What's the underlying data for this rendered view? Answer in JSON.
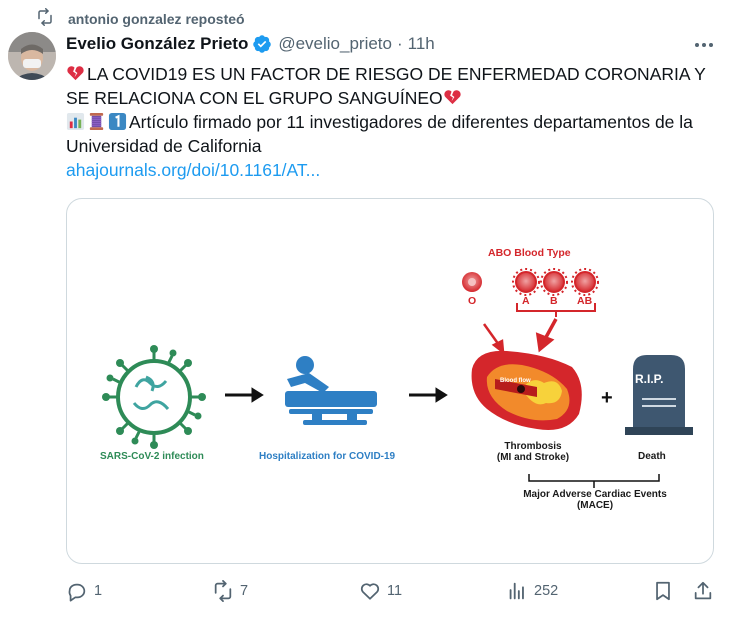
{
  "repost": {
    "text": "antonio gonzalez reposteó",
    "icon": "repost-icon"
  },
  "author": {
    "name": "Evelio González Prieto",
    "handle": "@evelio_prieto",
    "separator": "·",
    "time": "11h",
    "verified": true
  },
  "tweet": {
    "line1": "LA COVID19 ES UN FACTOR DE RIESGO DE ENFERMEDAD CORONARIA Y SE RELACIONA CON EL GRUPO SANGUÍNEO",
    "line2": "Artículo firmado por 11 investigadores de diferentes departamentos de la Universidad de California",
    "link": "ahajournals.org/doi/10.1161/AT..."
  },
  "figure": {
    "sars_label": "SARS-CoV-2 infection",
    "hosp_label": "Hospitalization  for COVID-19",
    "abo_title": "ABO Blood Type",
    "blood_types": [
      "O",
      "A",
      "B",
      "AB"
    ],
    "blood_flow": "Blood flow",
    "thrombosis": [
      "Thrombosis",
      "(MI and Stroke)"
    ],
    "plus": "+",
    "tombstone": "R.I.P.",
    "death": "Death",
    "mace": [
      "Major Adverse Cardiac Events",
      "(MACE)"
    ]
  },
  "actions": {
    "reply": {
      "icon": "reply-icon",
      "count": "1"
    },
    "repost": {
      "icon": "repost-icon",
      "count": "7"
    },
    "like": {
      "icon": "heart-icon",
      "count": "11"
    },
    "views": {
      "icon": "views-icon",
      "count": "252"
    },
    "bookmark": {
      "icon": "bookmark-icon"
    },
    "share": {
      "icon": "share-icon"
    }
  },
  "colors": {
    "accent": "#1d9bf0",
    "muted": "#536471",
    "verified": "#1d9bf0"
  }
}
